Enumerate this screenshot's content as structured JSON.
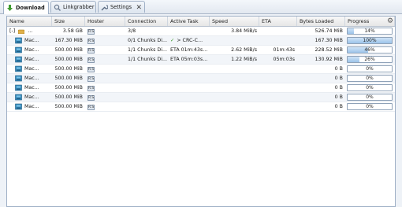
{
  "tabs": [
    {
      "label": "Download",
      "active": true,
      "icon": "download-arrow-icon"
    },
    {
      "label": "Linkgrabber",
      "active": false,
      "icon": "linkgrabber-icon"
    },
    {
      "label": "Settings",
      "active": false,
      "icon": "wrench-icon"
    }
  ],
  "columns": [
    "Name",
    "Size",
    "Hoster",
    "Connection",
    "Active Task",
    "Speed",
    "ETA",
    "Bytes Loaded",
    "Progress"
  ],
  "package": {
    "expander": "[-]",
    "name": "...",
    "size": "3.58 GB",
    "connection": "3/8",
    "speed": "3.84 MiB/s",
    "bytes_loaded": "526.74 MiB",
    "progress_label": "14%",
    "progress_value": 0.14
  },
  "files": [
    {
      "name": "Mac...",
      "size": "167.30 MiB",
      "connection": "0/1 Chunks Di...",
      "active_task": "> CRC-C...",
      "task_done": true,
      "speed": "",
      "eta": "",
      "bytes_loaded": "167.30 MiB",
      "progress_label": "100%",
      "progress_value": 1.0
    },
    {
      "name": "Mac...",
      "size": "500.00 MiB",
      "connection": "1/1 Chunks Di...",
      "active_task": "ETA 01m:43s...",
      "task_done": false,
      "speed": "2.62 MiB/s",
      "eta": "01m:43s",
      "bytes_loaded": "228.52 MiB",
      "progress_label": "46%",
      "progress_value": 0.46
    },
    {
      "name": "Mac...",
      "size": "500.00 MiB",
      "connection": "1/1 Chunks Di...",
      "active_task": "ETA 05m:03s...",
      "task_done": false,
      "speed": "1.22 MiB/s",
      "eta": "05m:03s",
      "bytes_loaded": "130.92 MiB",
      "progress_label": "26%",
      "progress_value": 0.26
    },
    {
      "name": "Mac...",
      "size": "500.00 MiB",
      "connection": "",
      "active_task": "",
      "task_done": false,
      "speed": "",
      "eta": "",
      "bytes_loaded": "0 B",
      "progress_label": "0%",
      "progress_value": 0
    },
    {
      "name": "Mac...",
      "size": "500.00 MiB",
      "connection": "",
      "active_task": "",
      "task_done": false,
      "speed": "",
      "eta": "",
      "bytes_loaded": "0 B",
      "progress_label": "0%",
      "progress_value": 0
    },
    {
      "name": "Mac...",
      "size": "500.00 MiB",
      "connection": "",
      "active_task": "",
      "task_done": false,
      "speed": "",
      "eta": "",
      "bytes_loaded": "0 B",
      "progress_label": "0%",
      "progress_value": 0
    },
    {
      "name": "Mac...",
      "size": "500.00 MiB",
      "connection": "",
      "active_task": "",
      "task_done": false,
      "speed": "",
      "eta": "",
      "bytes_loaded": "0 B",
      "progress_label": "0%",
      "progress_value": 0
    },
    {
      "name": "Mac...",
      "size": "500.00 MiB",
      "connection": "",
      "active_task": "",
      "task_done": false,
      "speed": "",
      "eta": "",
      "bytes_loaded": "0 B",
      "progress_label": "0%",
      "progress_value": 0
    }
  ],
  "hoster_badge": "R.S",
  "colors": {
    "progress_fill": "#9cc4ea",
    "check": "#3a9a2a",
    "border": "#9fb0c6"
  }
}
